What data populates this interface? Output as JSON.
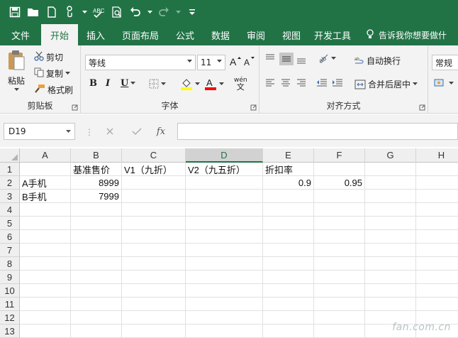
{
  "quick_access": {
    "icons": [
      "save-icon",
      "open-icon",
      "new-icon",
      "touch-mode-icon",
      "spelling-icon",
      "print-preview-icon",
      "undo-icon",
      "redo-icon",
      "customize-icon"
    ]
  },
  "tabs": [
    {
      "label": "文件"
    },
    {
      "label": "开始"
    },
    {
      "label": "插入"
    },
    {
      "label": "页面布局"
    },
    {
      "label": "公式"
    },
    {
      "label": "数据"
    },
    {
      "label": "审阅"
    },
    {
      "label": "视图"
    },
    {
      "label": "开发工具"
    }
  ],
  "tell_me": "告诉我你想要做什",
  "ribbon": {
    "clipboard": {
      "paste": "粘贴",
      "cut": "剪切",
      "copy": "复制",
      "format_painter": "格式刷",
      "group_label": "剪贴板"
    },
    "font": {
      "font_name": "等线",
      "font_size": "11",
      "bold": "B",
      "italic": "I",
      "underline": "U",
      "phonetic": "wén",
      "group_label": "字体",
      "fill_color": "#ffff00",
      "font_color": "#ff0000"
    },
    "alignment": {
      "wrap_text": "自动换行",
      "merge_center": "合并后居中",
      "group_label": "对齐方式"
    },
    "number": {
      "format": "常规"
    }
  },
  "formula_bar": {
    "name_box": "D19",
    "fx": "fx",
    "value": ""
  },
  "grid": {
    "columns": [
      "A",
      "B",
      "C",
      "D",
      "E",
      "F",
      "G",
      "H"
    ],
    "selected_column": "D",
    "rows": [
      {
        "num": "1",
        "cells": [
          "",
          "基准售价",
          "V1（九折）",
          "V2（九五折）",
          "折扣率",
          "",
          "",
          ""
        ]
      },
      {
        "num": "2",
        "cells": [
          "A手机",
          "8999",
          "",
          "",
          "0.9",
          "0.95",
          "",
          ""
        ]
      },
      {
        "num": "3",
        "cells": [
          "B手机",
          "7999",
          "",
          "",
          "",
          "",
          "",
          ""
        ]
      },
      {
        "num": "4",
        "cells": [
          "",
          "",
          "",
          "",
          "",
          "",
          "",
          ""
        ]
      },
      {
        "num": "5",
        "cells": [
          "",
          "",
          "",
          "",
          "",
          "",
          "",
          ""
        ]
      },
      {
        "num": "6",
        "cells": [
          "",
          "",
          "",
          "",
          "",
          "",
          "",
          ""
        ]
      },
      {
        "num": "7",
        "cells": [
          "",
          "",
          "",
          "",
          "",
          "",
          "",
          ""
        ]
      },
      {
        "num": "8",
        "cells": [
          "",
          "",
          "",
          "",
          "",
          "",
          "",
          ""
        ]
      },
      {
        "num": "9",
        "cells": [
          "",
          "",
          "",
          "",
          "",
          "",
          "",
          ""
        ]
      },
      {
        "num": "10",
        "cells": [
          "",
          "",
          "",
          "",
          "",
          "",
          "",
          ""
        ]
      },
      {
        "num": "11",
        "cells": [
          "",
          "",
          "",
          "",
          "",
          "",
          "",
          ""
        ]
      },
      {
        "num": "12",
        "cells": [
          "",
          "",
          "",
          "",
          "",
          "",
          "",
          ""
        ]
      },
      {
        "num": "13",
        "cells": [
          "",
          "",
          "",
          "",
          "",
          "",
          "",
          ""
        ]
      }
    ]
  },
  "watermark": "fan.com.cn",
  "colors": {
    "accent": "#217346",
    "ribbon_bg": "#f3f3f3"
  }
}
